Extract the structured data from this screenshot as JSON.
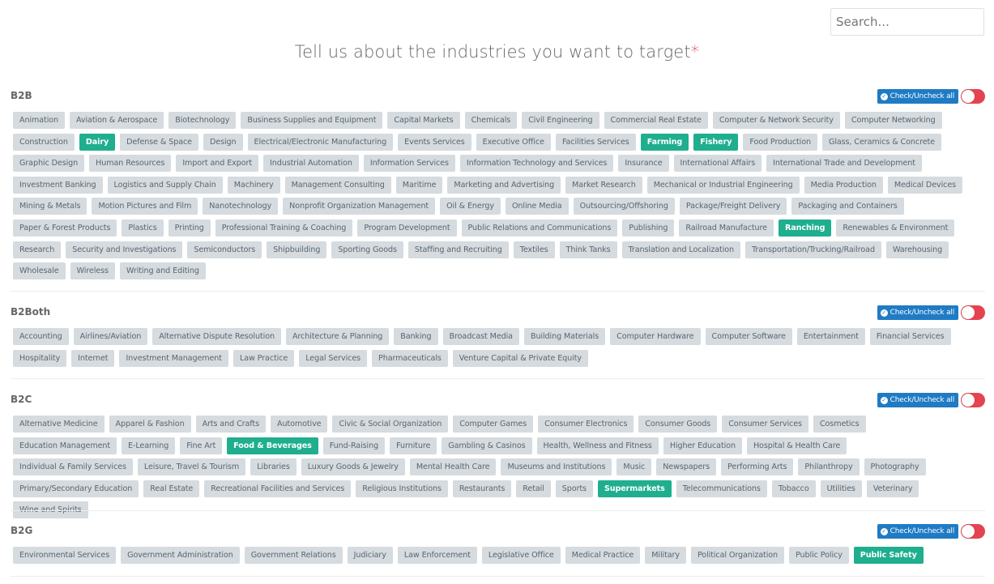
{
  "search": {
    "placeholder": "Search...",
    "value": ""
  },
  "header": {
    "title": "Tell us about the industries you want to target",
    "required_mark": "*"
  },
  "colors": {
    "selected_tag": "#1fae8e",
    "tag": "#d5dbdf",
    "check_button": "#1f7bc4",
    "toggle": "#e5434f",
    "required": "#e0364a"
  },
  "sections": [
    {
      "name": "B2B",
      "check_label": "Check/Uncheck all",
      "toggle_on": false,
      "tags": [
        {
          "label": "Animation",
          "selected": false
        },
        {
          "label": "Aviation & Aerospace",
          "selected": false
        },
        {
          "label": "Biotechnology",
          "selected": false
        },
        {
          "label": "Business Supplies and Equipment",
          "selected": false
        },
        {
          "label": "Capital Markets",
          "selected": false
        },
        {
          "label": "Chemicals",
          "selected": false
        },
        {
          "label": "Civil Engineering",
          "selected": false
        },
        {
          "label": "Commercial Real Estate",
          "selected": false
        },
        {
          "label": "Computer & Network Security",
          "selected": false
        },
        {
          "label": "Computer Networking",
          "selected": false
        },
        {
          "label": "Construction",
          "selected": false
        },
        {
          "label": "Dairy",
          "selected": true
        },
        {
          "label": "Defense & Space",
          "selected": false
        },
        {
          "label": "Design",
          "selected": false
        },
        {
          "label": "Electrical/Electronic Manufacturing",
          "selected": false
        },
        {
          "label": "Events Services",
          "selected": false
        },
        {
          "label": "Executive Office",
          "selected": false
        },
        {
          "label": "Facilities Services",
          "selected": false
        },
        {
          "label": "Farming",
          "selected": true
        },
        {
          "label": "Fishery",
          "selected": true
        },
        {
          "label": "Food Production",
          "selected": false
        },
        {
          "label": "Glass, Ceramics & Concrete",
          "selected": false
        },
        {
          "label": "Graphic Design",
          "selected": false
        },
        {
          "label": "Human Resources",
          "selected": false
        },
        {
          "label": "Import and Export",
          "selected": false
        },
        {
          "label": "Industrial Automation",
          "selected": false
        },
        {
          "label": "Information Services",
          "selected": false
        },
        {
          "label": "Information Technology and Services",
          "selected": false
        },
        {
          "label": "Insurance",
          "selected": false
        },
        {
          "label": "International Affairs",
          "selected": false
        },
        {
          "label": "International Trade and Development",
          "selected": false
        },
        {
          "label": "Investment Banking",
          "selected": false
        },
        {
          "label": "Logistics and Supply Chain",
          "selected": false
        },
        {
          "label": "Machinery",
          "selected": false
        },
        {
          "label": "Management Consulting",
          "selected": false
        },
        {
          "label": "Maritime",
          "selected": false
        },
        {
          "label": "Marketing and Advertising",
          "selected": false
        },
        {
          "label": "Market Research",
          "selected": false
        },
        {
          "label": "Mechanical or Industrial Engineering",
          "selected": false
        },
        {
          "label": "Media Production",
          "selected": false
        },
        {
          "label": "Medical Devices",
          "selected": false
        },
        {
          "label": "Mining & Metals",
          "selected": false
        },
        {
          "label": "Motion Pictures and Film",
          "selected": false
        },
        {
          "label": "Nanotechnology",
          "selected": false
        },
        {
          "label": "Nonprofit Organization Management",
          "selected": false
        },
        {
          "label": "Oil & Energy",
          "selected": false
        },
        {
          "label": "Online Media",
          "selected": false
        },
        {
          "label": "Outsourcing/Offshoring",
          "selected": false
        },
        {
          "label": "Package/Freight Delivery",
          "selected": false
        },
        {
          "label": "Packaging and Containers",
          "selected": false
        },
        {
          "label": "Paper & Forest Products",
          "selected": false
        },
        {
          "label": "Plastics",
          "selected": false
        },
        {
          "label": "Printing",
          "selected": false
        },
        {
          "label": "Professional Training & Coaching",
          "selected": false
        },
        {
          "label": "Program Development",
          "selected": false
        },
        {
          "label": "Public Relations and Communications",
          "selected": false
        },
        {
          "label": "Publishing",
          "selected": false
        },
        {
          "label": "Railroad Manufacture",
          "selected": false
        },
        {
          "label": "Ranching",
          "selected": true
        },
        {
          "label": "Renewables & Environment",
          "selected": false
        },
        {
          "label": "Research",
          "selected": false
        },
        {
          "label": "Security and Investigations",
          "selected": false
        },
        {
          "label": "Semiconductors",
          "selected": false
        },
        {
          "label": "Shipbuilding",
          "selected": false
        },
        {
          "label": "Sporting Goods",
          "selected": false
        },
        {
          "label": "Staffing and Recruiting",
          "selected": false
        },
        {
          "label": "Textiles",
          "selected": false
        },
        {
          "label": "Think Tanks",
          "selected": false
        },
        {
          "label": "Translation and Localization",
          "selected": false
        },
        {
          "label": "Transportation/Trucking/Railroad",
          "selected": false
        },
        {
          "label": "Warehousing",
          "selected": false
        },
        {
          "label": "Wholesale",
          "selected": false
        },
        {
          "label": "Wireless",
          "selected": false
        },
        {
          "label": "Writing and Editing",
          "selected": false
        }
      ]
    },
    {
      "name": "B2Both",
      "check_label": "Check/Uncheck all",
      "toggle_on": false,
      "tags": [
        {
          "label": "Accounting",
          "selected": false
        },
        {
          "label": "Airlines/Aviation",
          "selected": false
        },
        {
          "label": "Alternative Dispute Resolution",
          "selected": false
        },
        {
          "label": "Architecture & Planning",
          "selected": false
        },
        {
          "label": "Banking",
          "selected": false
        },
        {
          "label": "Broadcast Media",
          "selected": false
        },
        {
          "label": "Building Materials",
          "selected": false
        },
        {
          "label": "Computer Hardware",
          "selected": false
        },
        {
          "label": "Computer Software",
          "selected": false
        },
        {
          "label": "Entertainment",
          "selected": false
        },
        {
          "label": "Financial Services",
          "selected": false
        },
        {
          "label": "Hospitality",
          "selected": false
        },
        {
          "label": "Internet",
          "selected": false
        },
        {
          "label": "Investment Management",
          "selected": false
        },
        {
          "label": "Law Practice",
          "selected": false
        },
        {
          "label": "Legal Services",
          "selected": false
        },
        {
          "label": "Pharmaceuticals",
          "selected": false
        },
        {
          "label": "Venture Capital & Private Equity",
          "selected": false
        }
      ]
    },
    {
      "name": "B2C",
      "check_label": "Check/Uncheck all",
      "toggle_on": false,
      "tags": [
        {
          "label": "Alternative Medicine",
          "selected": false
        },
        {
          "label": "Apparel & Fashion",
          "selected": false
        },
        {
          "label": "Arts and Crafts",
          "selected": false
        },
        {
          "label": "Automotive",
          "selected": false
        },
        {
          "label": "Civic & Social Organization",
          "selected": false
        },
        {
          "label": "Computer Games",
          "selected": false
        },
        {
          "label": "Consumer Electronics",
          "selected": false
        },
        {
          "label": "Consumer Goods",
          "selected": false
        },
        {
          "label": "Consumer Services",
          "selected": false
        },
        {
          "label": "Cosmetics",
          "selected": false
        },
        {
          "label": "Education Management",
          "selected": false
        },
        {
          "label": "E-Learning",
          "selected": false
        },
        {
          "label": "Fine Art",
          "selected": false
        },
        {
          "label": "Food & Beverages",
          "selected": true
        },
        {
          "label": "Fund-Raising",
          "selected": false
        },
        {
          "label": "Furniture",
          "selected": false
        },
        {
          "label": "Gambling & Casinos",
          "selected": false
        },
        {
          "label": "Health, Wellness and Fitness",
          "selected": false
        },
        {
          "label": "Higher Education",
          "selected": false
        },
        {
          "label": "Hospital & Health Care",
          "selected": false
        },
        {
          "label": "Individual & Family Services",
          "selected": false
        },
        {
          "label": "Leisure, Travel & Tourism",
          "selected": false
        },
        {
          "label": "Libraries",
          "selected": false
        },
        {
          "label": "Luxury Goods & Jewelry",
          "selected": false
        },
        {
          "label": "Mental Health Care",
          "selected": false
        },
        {
          "label": "Museums and Institutions",
          "selected": false
        },
        {
          "label": "Music",
          "selected": false
        },
        {
          "label": "Newspapers",
          "selected": false
        },
        {
          "label": "Performing Arts",
          "selected": false
        },
        {
          "label": "Philanthropy",
          "selected": false
        },
        {
          "label": "Photography",
          "selected": false
        },
        {
          "label": "Primary/Secondary Education",
          "selected": false
        },
        {
          "label": "Real Estate",
          "selected": false
        },
        {
          "label": "Recreational Facilities and Services",
          "selected": false
        },
        {
          "label": "Religious Institutions",
          "selected": false
        },
        {
          "label": "Restaurants",
          "selected": false
        },
        {
          "label": "Retail",
          "selected": false
        },
        {
          "label": "Sports",
          "selected": false
        },
        {
          "label": "Supermarkets",
          "selected": true
        },
        {
          "label": "Telecommunications",
          "selected": false
        },
        {
          "label": "Tobacco",
          "selected": false
        },
        {
          "label": "Utilities",
          "selected": false
        },
        {
          "label": "Veterinary",
          "selected": false
        },
        {
          "label": "Wine and Spirits",
          "selected": false
        }
      ]
    },
    {
      "name": "B2G",
      "check_label": "Check/Uncheck all",
      "toggle_on": false,
      "tags": [
        {
          "label": "Environmental Services",
          "selected": false
        },
        {
          "label": "Government Administration",
          "selected": false
        },
        {
          "label": "Government Relations",
          "selected": false
        },
        {
          "label": "Judiciary",
          "selected": false
        },
        {
          "label": "Law Enforcement",
          "selected": false
        },
        {
          "label": "Legislative Office",
          "selected": false
        },
        {
          "label": "Medical Practice",
          "selected": false
        },
        {
          "label": "Military",
          "selected": false
        },
        {
          "label": "Political Organization",
          "selected": false
        },
        {
          "label": "Public Policy",
          "selected": false
        },
        {
          "label": "Public Safety",
          "selected": true
        }
      ]
    }
  ]
}
